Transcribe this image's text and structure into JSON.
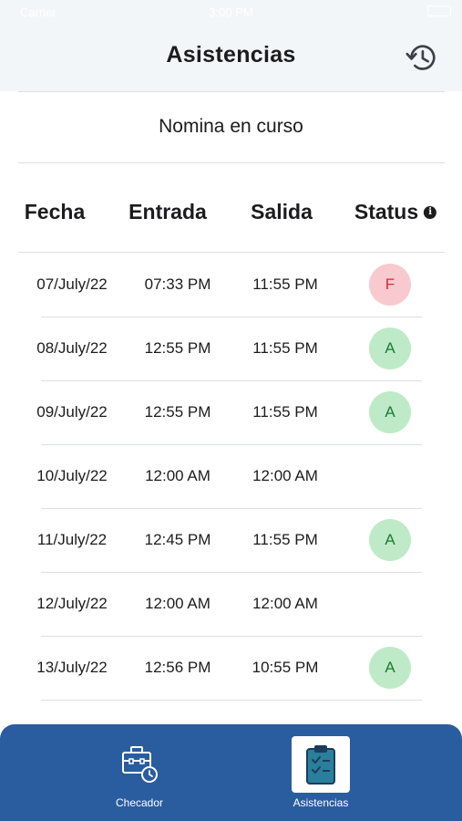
{
  "status_bar": {
    "carrier": "Carrier",
    "time": "3:00 PM"
  },
  "header": {
    "title": "Asistencias",
    "history_icon": "history-icon"
  },
  "subtitle": "Nomina en curso",
  "table": {
    "columns": [
      "Fecha",
      "Entrada",
      "Salida",
      "Status"
    ],
    "status_info_icon": "info-icon",
    "rows": [
      {
        "fecha": "07/July/22",
        "entrada": "07:33 PM",
        "salida": "11:55 PM",
        "status": "F"
      },
      {
        "fecha": "08/July/22",
        "entrada": "12:55 PM",
        "salida": "11:55 PM",
        "status": "A"
      },
      {
        "fecha": "09/July/22",
        "entrada": "12:55 PM",
        "salida": "11:55 PM",
        "status": "A"
      },
      {
        "fecha": "10/July/22",
        "entrada": "12:00 AM",
        "salida": "12:00 AM",
        "status": ""
      },
      {
        "fecha": "11/July/22",
        "entrada": "12:45 PM",
        "salida": "11:55 PM",
        "status": "A"
      },
      {
        "fecha": "12/July/22",
        "entrada": "12:00 AM",
        "salida": "12:00 AM",
        "status": ""
      },
      {
        "fecha": "13/July/22",
        "entrada": "12:56 PM",
        "salida": "10:55 PM",
        "status": "A"
      }
    ]
  },
  "tabs": [
    {
      "label": "Checador",
      "icon": "briefcase-clock-icon",
      "active": false
    },
    {
      "label": "Asistencias",
      "icon": "clipboard-check-icon",
      "active": true
    }
  ],
  "colors": {
    "tabbar": "#2a5d9f",
    "badge_f_bg": "#f8c9cf",
    "badge_f_text": "#d8283a",
    "badge_a_bg": "#bfeac7",
    "badge_a_text": "#1d7a34"
  }
}
